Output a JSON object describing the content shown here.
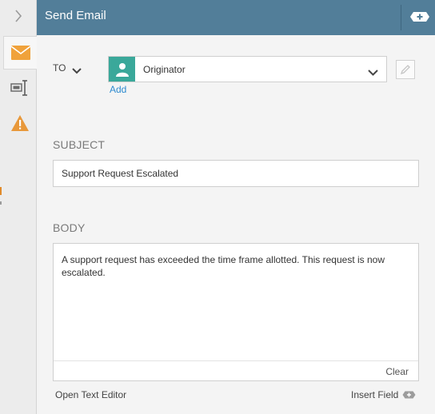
{
  "header": {
    "title": "Send Email"
  },
  "rail": {
    "collapse_icon": "chevron-right-icon",
    "tabs": [
      {
        "name": "email",
        "icon": "envelope-icon",
        "active": true
      },
      {
        "name": "fields",
        "icon": "text-cursor-icon",
        "active": false
      },
      {
        "name": "warnings",
        "icon": "warning-icon",
        "active": false
      }
    ]
  },
  "to": {
    "label": "TO",
    "recipient": "Originator",
    "add_label": "Add"
  },
  "subject": {
    "label": "SUBJECT",
    "value": "Support Request Escalated"
  },
  "body": {
    "label": "BODY",
    "text": "A support request has exceeded the time frame allotted. This request is now escalated.",
    "clear_label": "Clear"
  },
  "footer": {
    "open_editor_label": "Open Text Editor",
    "insert_field_label": "Insert Field"
  },
  "colors": {
    "header": "#527e99",
    "avatar": "#3aa89a",
    "link": "#2e8bd0",
    "accent_orange": "#e8a03c"
  }
}
